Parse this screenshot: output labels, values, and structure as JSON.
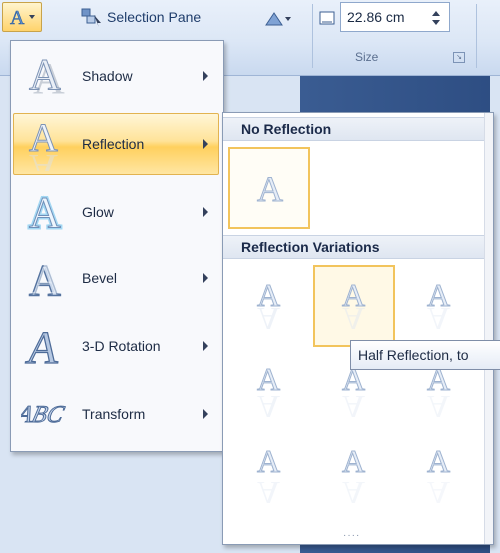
{
  "ribbon": {
    "selection_pane_label": "Selection Pane",
    "size_value": "22.86 cm",
    "size_group_label": "Size"
  },
  "menu": {
    "items": [
      {
        "label": "Shadow",
        "icon": "shadow-icon",
        "active": false
      },
      {
        "label": "Reflection",
        "icon": "reflection-icon",
        "active": true
      },
      {
        "label": "Glow",
        "icon": "glow-icon",
        "active": false
      },
      {
        "label": "Bevel",
        "icon": "bevel-icon",
        "active": false
      },
      {
        "label": "3-D Rotation",
        "icon": "3d-rotation-icon",
        "active": false
      },
      {
        "label": "Transform",
        "icon": "transform-icon",
        "active": false
      }
    ]
  },
  "gallery": {
    "no_reflection_header": "No Reflection",
    "variations_header": "Reflection Variations",
    "tooltip": "Half Reflection, to",
    "resize_grip": "····"
  },
  "colors": {
    "accent_highlight": "#ffd05e",
    "selection_border": "#f2c45c",
    "ribbon_bg": "#dce7f6"
  }
}
